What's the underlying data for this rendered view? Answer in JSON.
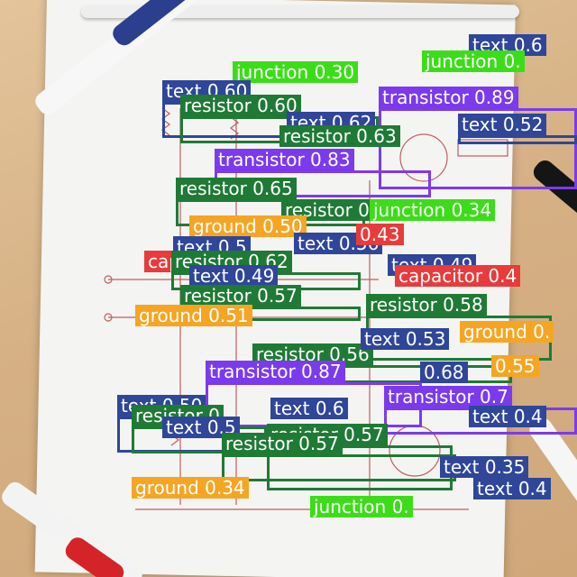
{
  "image": {
    "description_colors": {
      "text": "#2f4699",
      "resistor": "#1f7a35",
      "transistor": "#7c3aed",
      "junction": "#3ddc1a",
      "ground": "#f5a524",
      "capacitor": "#e83b3b"
    }
  },
  "detections": [
    {
      "label": "text 0.6",
      "cls": "text"
    },
    {
      "label": "junction 0.30",
      "cls": "junction"
    },
    {
      "label": "junction 0.",
      "cls": "junction"
    },
    {
      "label": "text 0.60",
      "cls": "text"
    },
    {
      "label": "resistor 0.60",
      "cls": "resistor"
    },
    {
      "label": "transistor 0.89",
      "cls": "transistor"
    },
    {
      "label": "text 0.62",
      "cls": "text"
    },
    {
      "label": "text 0.52",
      "cls": "text"
    },
    {
      "label": "resistor 0.63",
      "cls": "resistor"
    },
    {
      "label": "transistor 0.83",
      "cls": "transistor"
    },
    {
      "label": "resistor 0.65",
      "cls": "resistor"
    },
    {
      "label": "resistor 0.63",
      "cls": "resistor"
    },
    {
      "label": "junction 0.34",
      "cls": "junction"
    },
    {
      "label": "ground 0.50",
      "cls": "ground"
    },
    {
      "label": "text 0.56",
      "cls": "text"
    },
    {
      "label": "0.43",
      "cls": "capacitor"
    },
    {
      "label": "text 0.5",
      "cls": "text"
    },
    {
      "label": "capacitor",
      "cls": "capacitor"
    },
    {
      "label": "resistor 0.62",
      "cls": "resistor"
    },
    {
      "label": "text 0.49",
      "cls": "text"
    },
    {
      "label": "capacitor 0.4",
      "cls": "capacitor"
    },
    {
      "label": "text 0.49",
      "cls": "text"
    },
    {
      "label": "resistor 0.57",
      "cls": "resistor"
    },
    {
      "label": "resistor 0.58",
      "cls": "resistor"
    },
    {
      "label": "ground 0.51",
      "cls": "ground"
    },
    {
      "label": "ground 0.",
      "cls": "ground"
    },
    {
      "label": "resistor 0.56",
      "cls": "resistor"
    },
    {
      "label": "text 0.53",
      "cls": "text"
    },
    {
      "label": "0.68",
      "cls": "text"
    },
    {
      "label": "0.55",
      "cls": "ground"
    },
    {
      "label": "transistor 0.87",
      "cls": "transistor"
    },
    {
      "label": "transistor 0.7",
      "cls": "transistor"
    },
    {
      "label": "text 0.50",
      "cls": "text"
    },
    {
      "label": "text 0.6",
      "cls": "text"
    },
    {
      "label": "resistor 0",
      "cls": "resistor"
    },
    {
      "label": "resistor 0.57",
      "cls": "resistor"
    },
    {
      "label": "text 0.4",
      "cls": "text"
    },
    {
      "label": "text 0.5",
      "cls": "text"
    },
    {
      "label": "resistor 0.57",
      "cls": "resistor"
    },
    {
      "label": "text 0.35",
      "cls": "text"
    },
    {
      "label": "text 0.4",
      "cls": "text"
    },
    {
      "label": "ground 0.34",
      "cls": "ground"
    },
    {
      "label": "junction 0.",
      "cls": "junction"
    }
  ]
}
